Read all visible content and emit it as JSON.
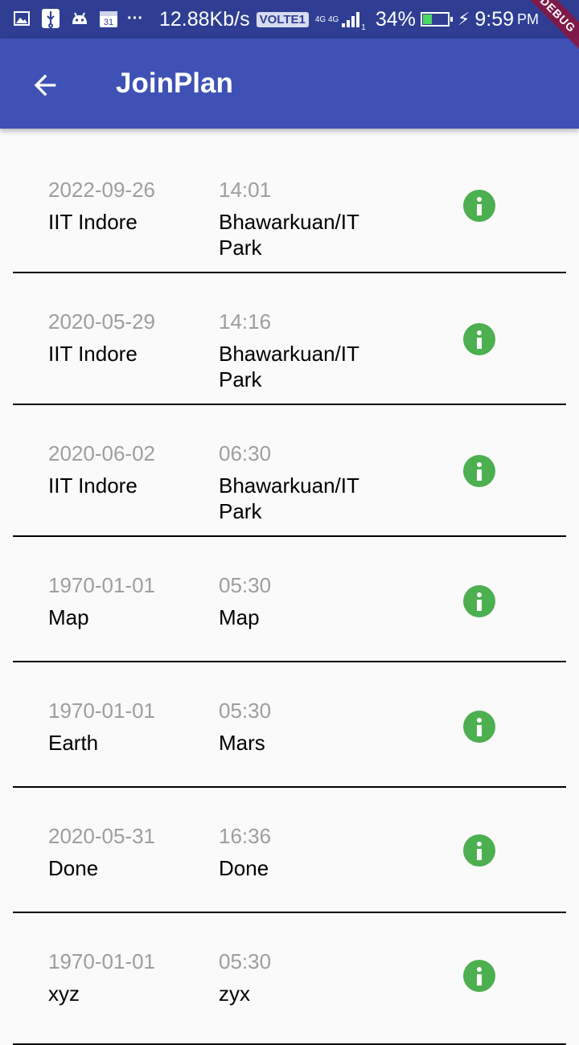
{
  "status_bar": {
    "net_speed": "12.88Kb/s",
    "volte": "VOLTE1",
    "network": "4G 4G",
    "sim": "1",
    "battery_pct": "34%",
    "battery_level": 0.34,
    "time": "9:59",
    "ampm": "PM",
    "overflow": "···",
    "icons": [
      "image-icon",
      "usb-icon",
      "android-icon",
      "calendar-icon"
    ]
  },
  "app_bar": {
    "title": "JoinPlan",
    "back_icon": "arrow-back-icon",
    "debug_label": "DEBUG"
  },
  "plans": [
    {
      "date": "2022-09-26",
      "time": "14:01",
      "from": "IIT Indore",
      "to": "Bhawarkuan/IT Park"
    },
    {
      "date": "2020-05-29",
      "time": "14:16",
      "from": "IIT Indore",
      "to": "Bhawarkuan/IT Park"
    },
    {
      "date": "2020-06-02",
      "time": "06:30",
      "from": "IIT Indore",
      "to": "Bhawarkuan/IT Park"
    },
    {
      "date": "1970-01-01",
      "time": "05:30",
      "from": "Map",
      "to": "Map"
    },
    {
      "date": "1970-01-01",
      "time": "05:30",
      "from": "Earth",
      "to": "Mars"
    },
    {
      "date": "2020-05-31",
      "time": "16:36",
      "from": "Done",
      "to": "Done"
    },
    {
      "date": "1970-01-01",
      "time": "05:30",
      "from": "xyz",
      "to": "zyx"
    }
  ],
  "colors": {
    "app_bar": "#3f51b5",
    "status_bar": "#2f3e93",
    "info_icon": "#4caf50",
    "muted_text": "#9e9e9e",
    "divider": "#000000"
  }
}
